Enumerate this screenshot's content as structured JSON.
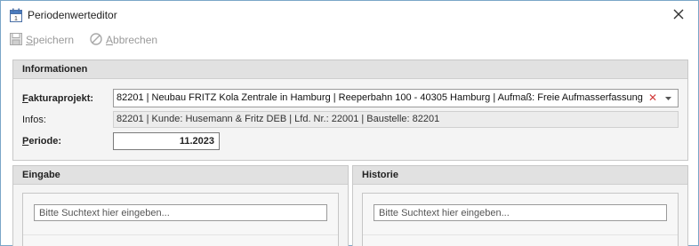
{
  "window": {
    "title": "Periodenwerteditor"
  },
  "toolbar": {
    "save_prefix": "S",
    "save_rest": "peichern",
    "cancel_prefix": "A",
    "cancel_rest": "bbrechen"
  },
  "info": {
    "header": "Informationen",
    "fakturaprojekt_label_prefix": "F",
    "fakturaprojekt_label_rest": "akturaprojekt:",
    "fakturaprojekt_value": "82201 | Neubau FRITZ Kola Zentrale in Hamburg | Reeperbahn 100 - 40305 Hamburg | Aufmaß: Freie Aufmasserfassung",
    "infos_label": "Infos:",
    "infos_value": "82201 | Kunde: Husemann & Fritz DEB | Lfd. Nr.: 22001 | Baustelle: 82201",
    "periode_label_prefix": "P",
    "periode_label_rest": "eriode:",
    "periode_value": "11.2023"
  },
  "eingabe": {
    "header": "Eingabe",
    "search_placeholder": "Bitte Suchtext hier eingeben..."
  },
  "historie": {
    "header": "Historie",
    "search_placeholder": "Bitte Suchtext hier eingeben..."
  },
  "colors": {
    "window_border": "#7aa6c8",
    "header_bg": "#e1e1e1",
    "panel_bg": "#f4f4f4",
    "disabled_text": "#9a9a9a",
    "clear_red": "#d23a3a"
  },
  "icons": [
    "calendar-icon",
    "close-icon",
    "save-icon",
    "cancel-icon",
    "clear-icon",
    "chevron-down-icon"
  ]
}
